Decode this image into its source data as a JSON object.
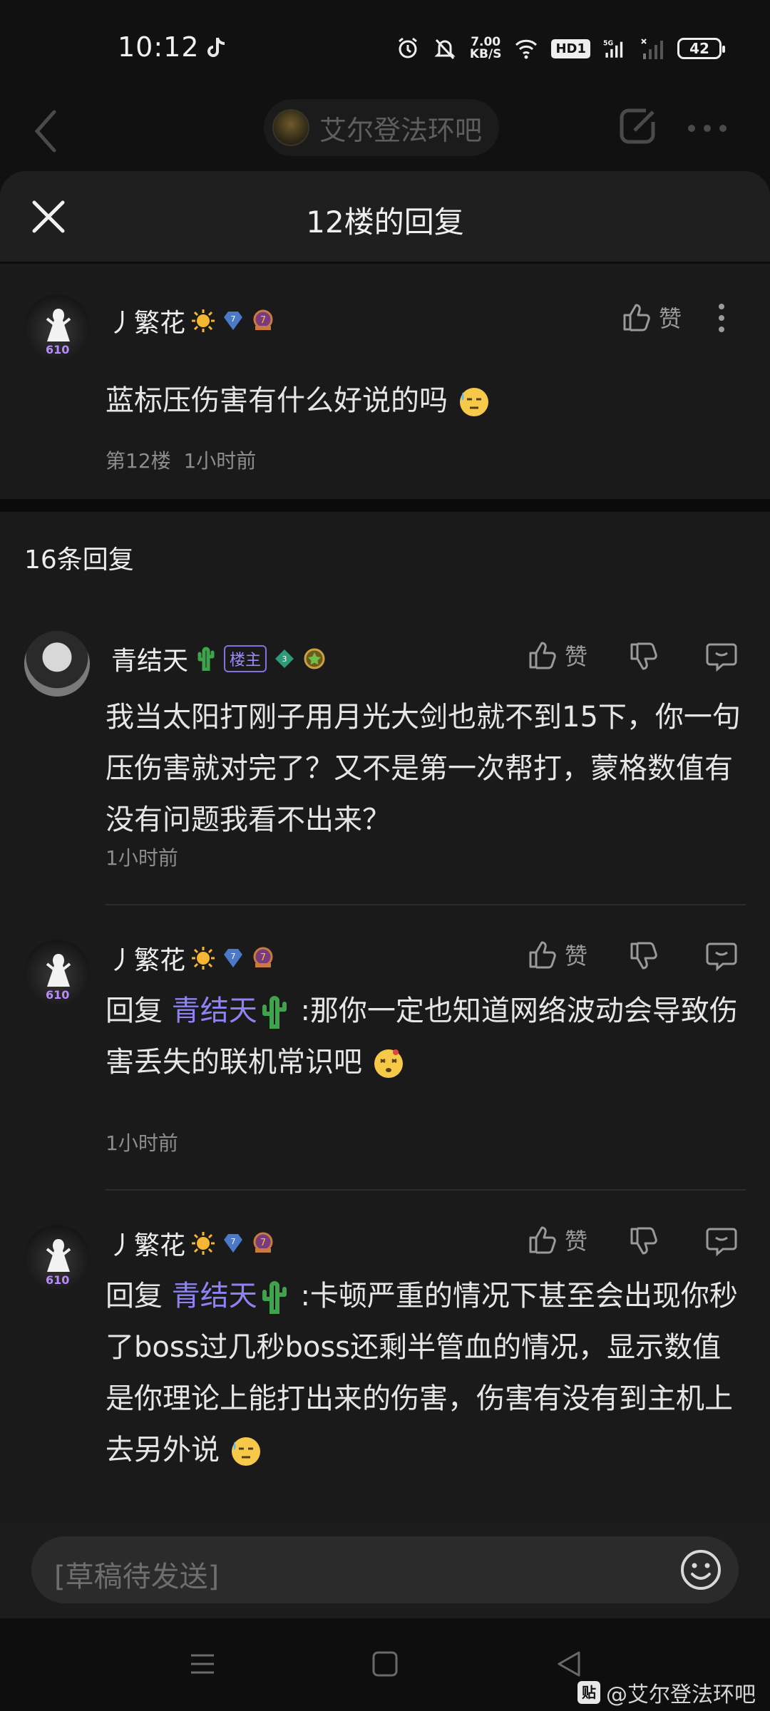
{
  "status_bar": {
    "time": "10:12",
    "net_speed_value": "7.00",
    "net_speed_unit": "KB/S",
    "hd_label": "HD1",
    "signal_label": "5G",
    "battery": "42"
  },
  "top_nav": {
    "forum_name": "艾尔登法环吧"
  },
  "sheet": {
    "title": "12楼的回复"
  },
  "origin_post": {
    "username": "丿繁花",
    "level": "7",
    "avatar_badge": "610",
    "text": "蓝标压伤害有什么好说的吗",
    "floor": "第12楼",
    "time": "1小时前",
    "like_label": "赞"
  },
  "reply_count": "16条回复",
  "replies": [
    {
      "username": "青结天",
      "owner_tag": "楼主",
      "level": "3",
      "text": "我当太阳打刚子用月光大剑也就不到15下，你一句压伤害就对完了？又不是第一次帮打，蒙格数值有没有问题我看不出来？",
      "time": "1小时前",
      "like_label": "赞"
    },
    {
      "username": "丿繁花",
      "level": "7",
      "avatar_badge": "610",
      "reply_prefix": "回复",
      "mention": "青结天",
      "text": ":那你一定也知道网络波动会导致伤害丢失的联机常识吧",
      "time": "1小时前",
      "like_label": "赞"
    },
    {
      "username": "丿繁花",
      "level": "7",
      "avatar_badge": "610",
      "reply_prefix": "回复",
      "mention": "青结天",
      "text": ":卡顿严重的情况下甚至会出现你秒了boss过几秒boss还剩半管血的情况，显示数值是你理论上能打出来的伤害，伤害有没有到主机上去另外说",
      "like_label": "赞"
    }
  ],
  "input_bar": {
    "placeholder": "[草稿待发送]"
  },
  "watermark": {
    "logo": "贴",
    "text": "@艾尔登法环吧"
  },
  "colors": {
    "background": "#111111",
    "sheet": "#1a1a1a",
    "mention": "#8f82f5",
    "meta": "#8d8d8d"
  }
}
